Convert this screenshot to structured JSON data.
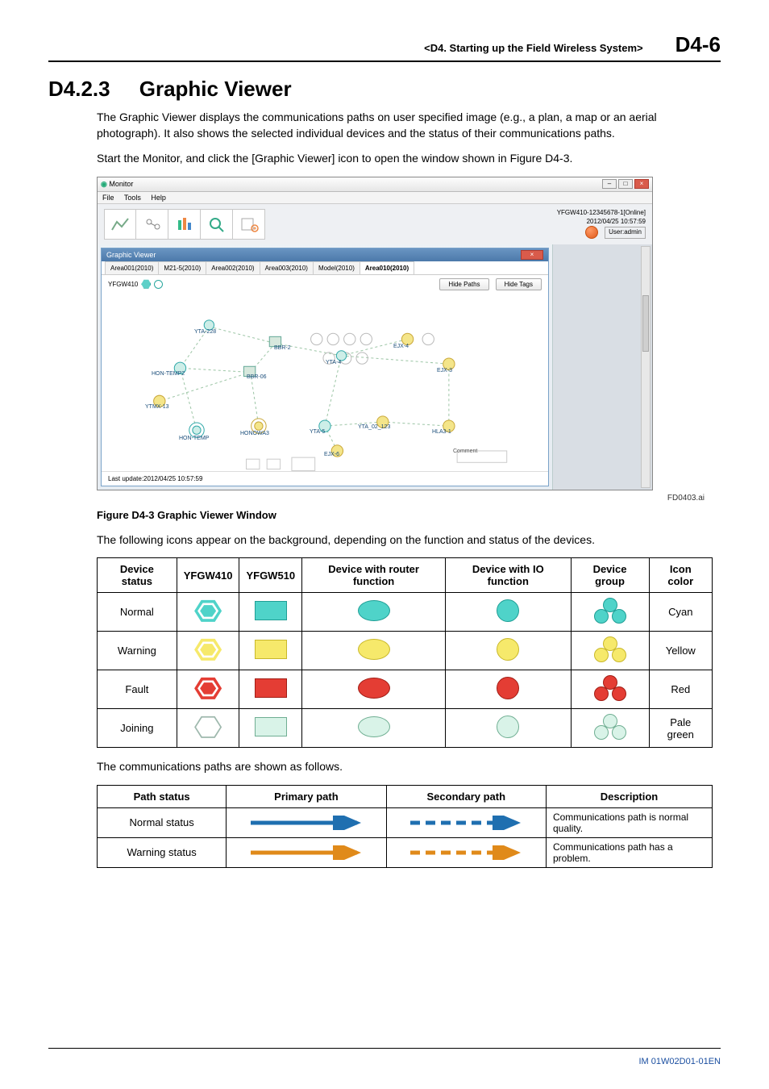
{
  "header": {
    "chapter": "<D4.  Starting up the Field Wireless System>",
    "page": "D4-6"
  },
  "section": {
    "number": "D4.2.3",
    "title": "Graphic Viewer"
  },
  "para1": "The Graphic Viewer displays the communications paths on user specified image (e.g., a plan, a map or an aerial photograph). It also shows the selected individual devices and the status of their communications paths.",
  "para2": "Start the Monitor, and click the [Graphic Viewer] icon to open the window shown in Figure D4-3.",
  "screenshot": {
    "window_title": "Monitor",
    "menu": {
      "file": "File",
      "tools": "Tools",
      "help": "Help"
    },
    "status": {
      "device": "YFGW410-12345678-1[Online]",
      "timestamp": "2012/04/25 10:57:59",
      "user_label": "User:admin"
    },
    "inner_title": "Graphic Viewer",
    "tabs": {
      "t1": "Area001(2010)",
      "t2": "M21-5(2010)",
      "t3": "Area002(2010)",
      "t4": "Area003(2010)",
      "t5": "Model(2010)",
      "t6": "Area010(2010)"
    },
    "subbar": {
      "dev": "YFGW410",
      "hide_paths": "Hide Paths",
      "hide_tags": "Hide Tags"
    },
    "nodes": {
      "yta228": "YTA-228",
      "bbr2": "BBR-2",
      "ejx4": "EJX-4",
      "yta4": "YTA-4",
      "ejx3": "EJX-3",
      "hon_temp2": "HON-TEMP2",
      "bbr06": "BBR-06",
      "ytmx13": "YTMX-13",
      "hon_temp": "HON-TEMP",
      "honowa3": "HONOWA3",
      "yta5": "YTA-5",
      "yta02_123": "YTA_02_123",
      "hla31": "HLA3-1",
      "ejx6": "EJX-6",
      "comment_box": "Comment"
    },
    "footer": "Last update:2012/04/25 10:57:59"
  },
  "figure_id": "FD0403.ai",
  "figure_caption": "Figure D4-3  Graphic Viewer Window",
  "para3": "The following icons appear on the background, depending on the function and status of the devices.",
  "icon_table": {
    "headers": {
      "c1": "Device status",
      "c2": "YFGW410",
      "c3": "YFGW510",
      "c4": "Device with router function",
      "c5": "Device with IO function",
      "c6": "Device group",
      "c7": "Icon color"
    },
    "rows": {
      "r1": {
        "status": "Normal",
        "color": "Cyan"
      },
      "r2": {
        "status": "Warning",
        "color": "Yellow"
      },
      "r3": {
        "status": "Fault",
        "color": "Red"
      },
      "r4": {
        "status": "Joining",
        "color": "Pale green"
      }
    }
  },
  "para4": "The communications paths are shown as follows.",
  "path_table": {
    "headers": {
      "c1": "Path status",
      "c2": "Primary path",
      "c3": "Secondary path",
      "c4": "Description"
    },
    "rows": {
      "r1": {
        "status": "Normal status",
        "desc": "Communications path is normal quality."
      },
      "r2": {
        "status": "Warning status",
        "desc": "Communications path has a problem."
      }
    }
  },
  "colors": {
    "path_normal": "#1f6fb0",
    "path_warning": "#e08a1a"
  },
  "footer_doc": "IM 01W02D01-01EN"
}
